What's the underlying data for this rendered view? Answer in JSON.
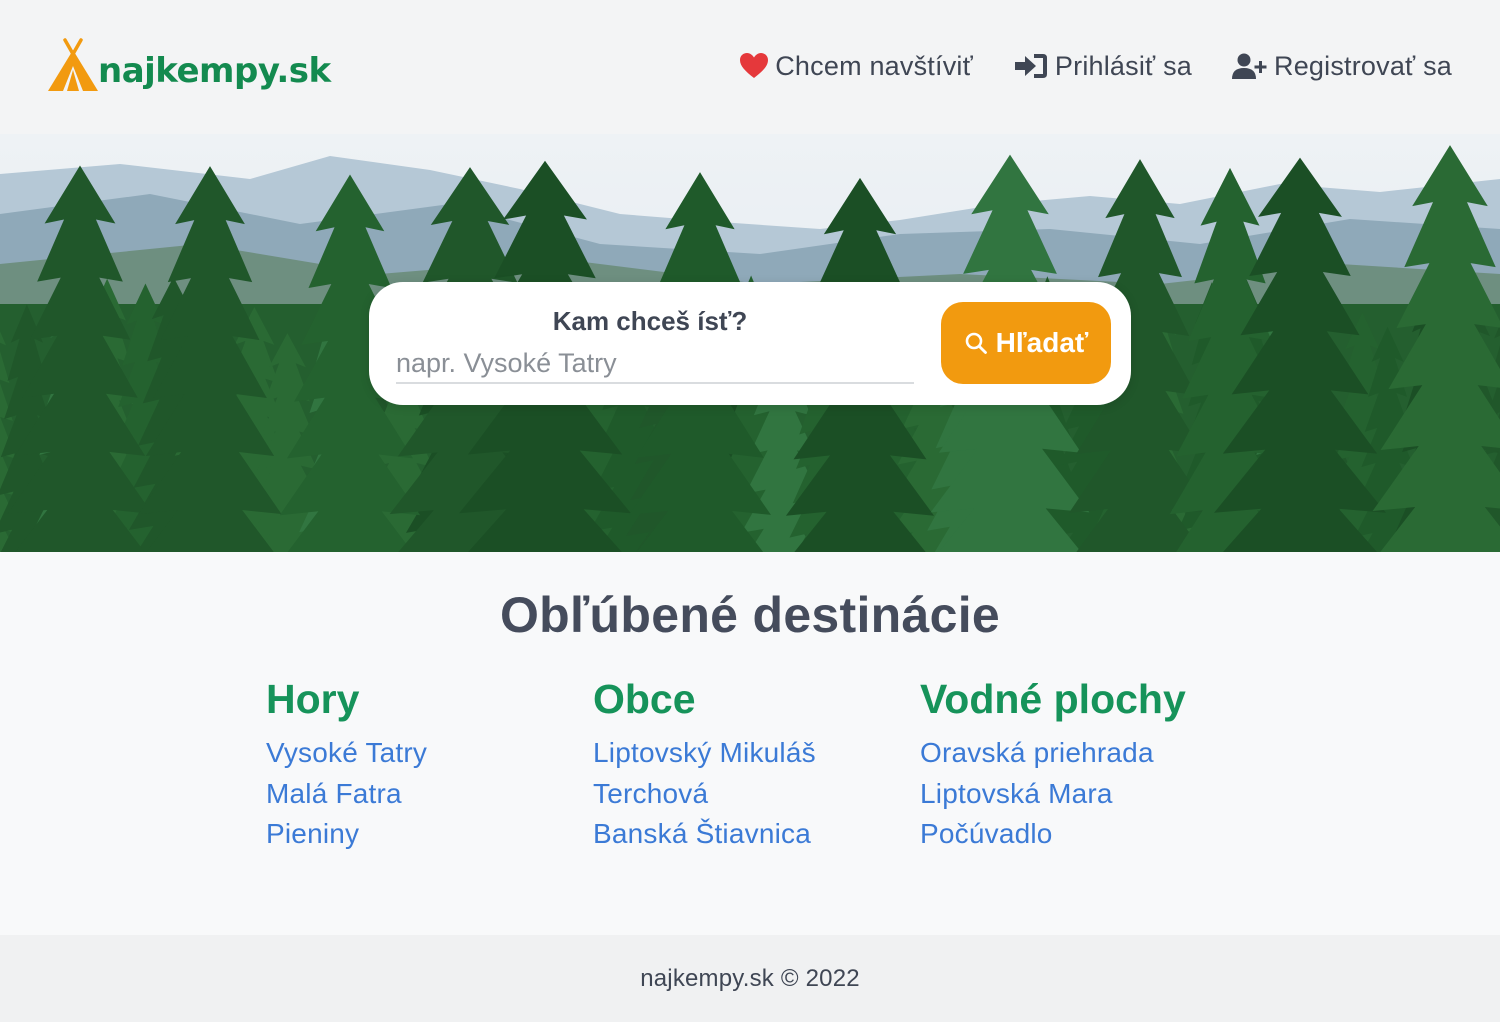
{
  "header": {
    "logo_text": "najkempy.sk",
    "nav": [
      {
        "label": "Chcem navštíviť",
        "icon": "heart-icon"
      },
      {
        "label": "Prihlásiť sa",
        "icon": "sign-in-icon"
      },
      {
        "label": "Registrovať sa",
        "icon": "user-plus-icon"
      }
    ]
  },
  "search": {
    "label": "Kam chceš ísť?",
    "placeholder": "napr. Vysoké Tatry",
    "value": "",
    "button_label": "Hľadať"
  },
  "destinations": {
    "title": "Obľúbené destinácie",
    "columns": [
      {
        "heading": "Hory",
        "links": [
          "Vysoké Tatry",
          "Malá Fatra",
          "Pieniny"
        ]
      },
      {
        "heading": "Obce",
        "links": [
          "Liptovský Mikuláš",
          "Terchová",
          "Banská Štiavnica"
        ]
      },
      {
        "heading": "Vodné plochy",
        "links": [
          "Oravská priehrada",
          "Liptovská Mara",
          "Počúvadlo"
        ]
      }
    ]
  },
  "footer": {
    "text": "najkempy.sk © 2022"
  },
  "colors": {
    "brand_green": "#138a4f",
    "accent_orange": "#f29a0f",
    "link_blue": "#3b7ad6",
    "heart_red": "#e5383b"
  }
}
